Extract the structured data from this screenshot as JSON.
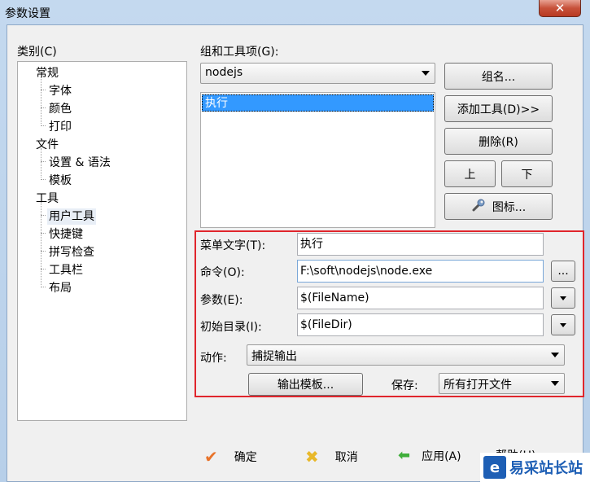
{
  "window": {
    "title": "参数设置",
    "close_label": "✕"
  },
  "category": {
    "label": "类别(C)",
    "tree": [
      {
        "label": "常规",
        "children": [
          "字体",
          "颜色",
          "打印"
        ]
      },
      {
        "label": "文件",
        "children": [
          "设置 & 语法",
          "模板"
        ]
      },
      {
        "label": "工具",
        "children": [
          "用户工具",
          "快捷键",
          "拼写检查",
          "工具栏",
          "布局"
        ]
      }
    ],
    "selected": "用户工具"
  },
  "group": {
    "label": "组和工具项(G):",
    "selected": "nodejs",
    "list_items": [
      "执行"
    ]
  },
  "side_buttons": {
    "group_name": "组名...",
    "add_tool": "添加工具(D)>>",
    "delete": "删除(R)",
    "up": "上",
    "down": "下",
    "icon": "图标..."
  },
  "form": {
    "menu_text_label": "菜单文字(T):",
    "menu_text_value": "执行",
    "command_label": "命令(O):",
    "command_value": "F:\\soft\\nodejs\\node.exe",
    "browse_label": "...",
    "args_label": "参数(E):",
    "args_value": "$(FileName)",
    "dir_label": "初始目录(I):",
    "dir_value": "$(FileDir)",
    "action_label": "动作:",
    "action_value": "捕捉输出",
    "output_template": "输出模板...",
    "save_label": "保存:",
    "save_value": "所有打开文件"
  },
  "footer": {
    "ok": "确定",
    "cancel": "取消",
    "apply": "应用(A)",
    "help": "帮助(H)"
  },
  "watermark": {
    "logo": "e",
    "text": "易采站长站"
  }
}
